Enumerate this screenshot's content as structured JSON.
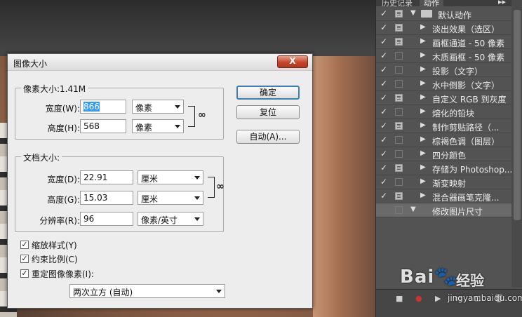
{
  "dialog": {
    "title": "图像大小",
    "close_label": "X",
    "pixel_dimensions": {
      "legend": "像素大小:1.41M",
      "width_label": "宽度(W):",
      "width_value": "866",
      "width_unit": "像素",
      "height_label": "高度(H):",
      "height_value": "568",
      "height_unit": "像素"
    },
    "document_size": {
      "legend": "文档大小:",
      "width_label": "宽度(D):",
      "width_value": "22.91",
      "width_unit": "厘米",
      "height_label": "高度(G):",
      "height_value": "15.03",
      "height_unit": "厘米",
      "resolution_label": "分辨率(R):",
      "resolution_value": "96",
      "resolution_unit": "像素/英寸"
    },
    "buttons": {
      "ok": "确定",
      "reset": "复位",
      "auto": "自动(A)..."
    },
    "options": {
      "scale_styles": "缩放样式(Y)",
      "constrain": "约束比例(C)",
      "resample": "重定图像像素(I):",
      "resample_method": "两次立方 (自动)"
    }
  },
  "panel": {
    "tab_history": "历史记录",
    "tab_actions": "动作",
    "menu_icon": "▸▸",
    "menu_icon2": "≡",
    "actions": [
      {
        "label": "默认动作",
        "check": "✓",
        "dialog": true,
        "type": "set"
      },
      {
        "label": "淡出效果（选区）",
        "check": "✓",
        "dialog": true,
        "type": "action"
      },
      {
        "label": "画框通道 - 50 像素",
        "check": "✓",
        "dialog": true,
        "type": "action"
      },
      {
        "label": "木质画框 - 50 像素",
        "check": "✓",
        "dialog": false,
        "type": "action"
      },
      {
        "label": "投影（文字）",
        "check": "✓",
        "dialog": false,
        "type": "action"
      },
      {
        "label": "水中倒影（文字）",
        "check": "✓",
        "dialog": false,
        "type": "action"
      },
      {
        "label": "自定义 RGB 到灰度",
        "check": "✓",
        "dialog": true,
        "type": "action"
      },
      {
        "label": "熔化的铅块",
        "check": "✓",
        "dialog": false,
        "type": "action"
      },
      {
        "label": "制作剪贴路径（...",
        "check": "✓",
        "dialog": true,
        "type": "action"
      },
      {
        "label": "棕褐色调（图层）",
        "check": "✓",
        "dialog": false,
        "type": "action"
      },
      {
        "label": "四分颜色",
        "check": "✓",
        "dialog": false,
        "type": "action"
      },
      {
        "label": "存储为 Photoshop...",
        "check": "✓",
        "dialog": true,
        "type": "action"
      },
      {
        "label": "渐变映射",
        "check": "✓",
        "dialog": false,
        "type": "action"
      },
      {
        "label": "混合器画笔克隆...",
        "check": "✓",
        "dialog": true,
        "type": "action"
      },
      {
        "label": "修改图片尺寸",
        "check": "",
        "dialog": false,
        "type": "action-open"
      }
    ],
    "bottom_icons": [
      "■",
      "●",
      "▶",
      "▭",
      "⊡",
      "🗑"
    ]
  },
  "watermark": {
    "logo": "Bai🐾",
    "text": "经验",
    "url": "jingyan.baidu.com"
  }
}
